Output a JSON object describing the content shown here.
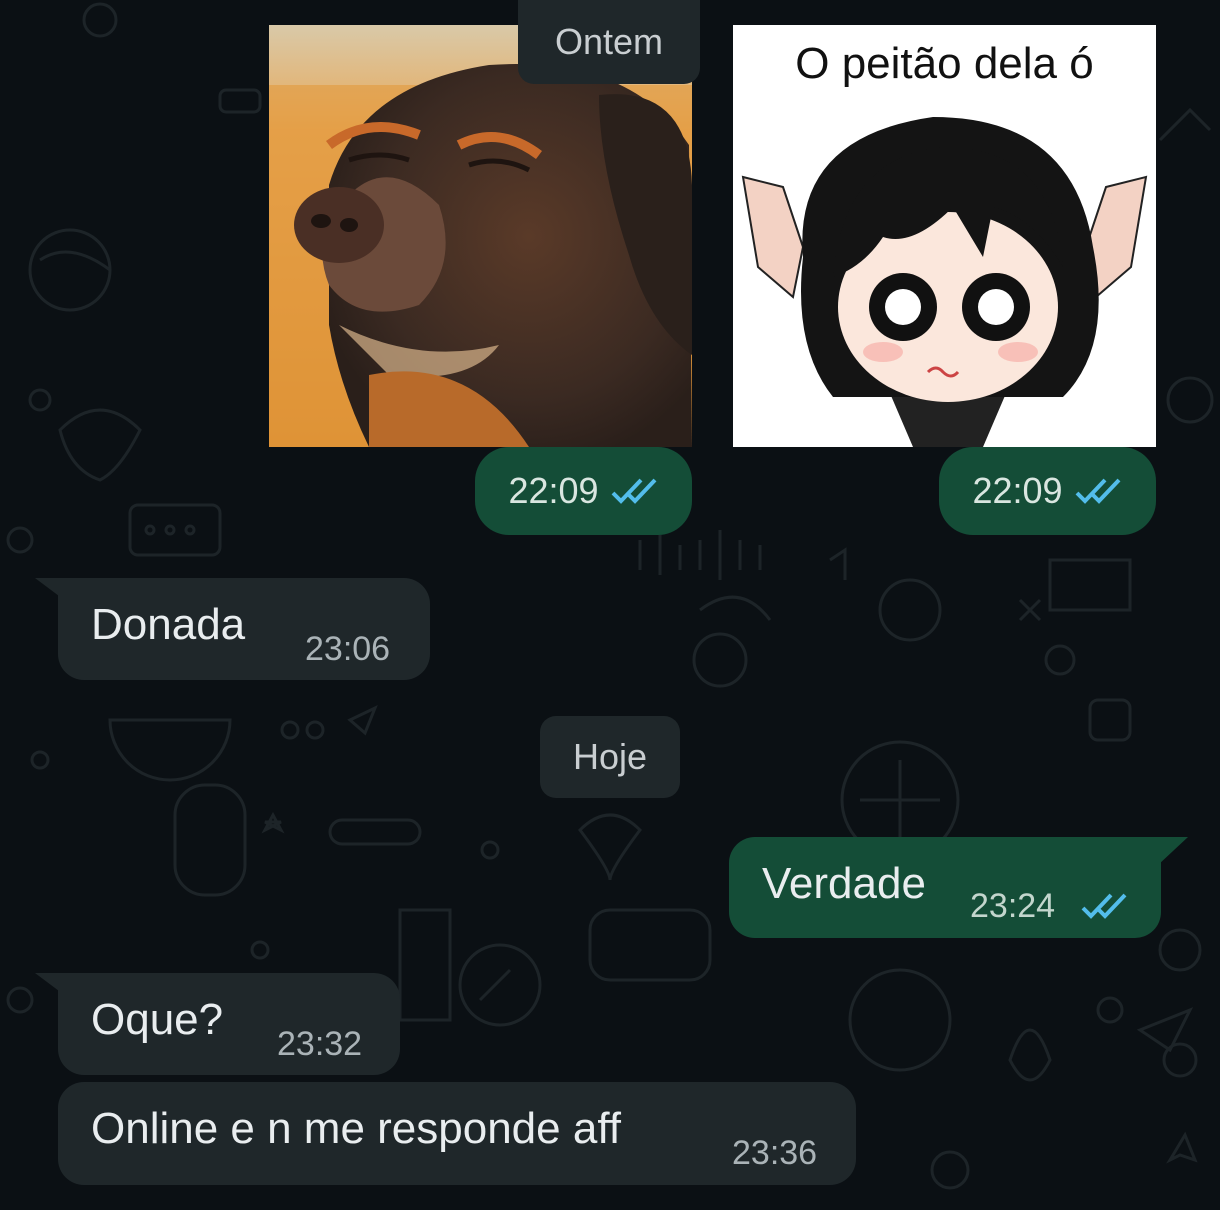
{
  "date_separators": {
    "yesterday": "Ontem",
    "today": "Hoje"
  },
  "sticker_dog": {
    "icon": "dog-meme-sticker",
    "time": "22:09",
    "status_icon": "double-check-read-icon"
  },
  "sticker_anime": {
    "caption": "O peitão dela ó",
    "icon": "anime-girl-sticker",
    "time": "22:09",
    "status_icon": "double-check-read-icon"
  },
  "messages": [
    {
      "direction": "in",
      "text": "Donada",
      "time": "23:06"
    },
    {
      "direction": "out",
      "text": "Verdade",
      "time": "23:24",
      "status_icon": "double-check-read-icon"
    },
    {
      "direction": "in",
      "text": "Oque?",
      "time": "23:32"
    },
    {
      "direction": "in",
      "text": "Online e n me responde aff",
      "time": "23:36"
    }
  ],
  "colors": {
    "background": "#0b1014",
    "incoming_bubble": "#1f272a",
    "outgoing_bubble": "#144d37",
    "read_ticks": "#53bdeb"
  }
}
